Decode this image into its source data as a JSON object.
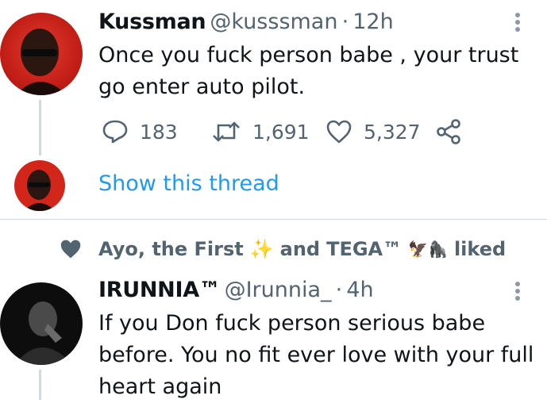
{
  "tweet1": {
    "display_name": "Kussman",
    "handle": "@kusssman",
    "separator": "·",
    "time": "12h",
    "text_line1": "Once you fuck person babe , your trust",
    "text_line2": "go enter auto pilot.",
    "replies": "183",
    "retweets": "1,691",
    "likes": "5,327"
  },
  "thread": {
    "show_label": "Show this thread"
  },
  "social_context": {
    "user1": "Ayo, the First",
    "emoji1": "✨",
    "conj": "and",
    "user2": "TEGA™",
    "emoji2": "🦅🦍",
    "suffix": "liked"
  },
  "tweet2": {
    "display_name": "IRUNNIA™",
    "handle": "@Irunnia_",
    "separator": "·",
    "time": "4h",
    "text_line1": "If you Don fuck person serious babe",
    "text_line2": "before. You no fit ever love with your full",
    "text_line3": "heart again"
  },
  "colors": {
    "accent": "#1d9bf0",
    "muted": "#536471",
    "text": "#0f1419",
    "divider": "#cfd9de"
  },
  "icons": [
    "more-icon",
    "reply-icon",
    "retweet-icon",
    "like-icon",
    "share-icon",
    "heart-filled-icon"
  ]
}
